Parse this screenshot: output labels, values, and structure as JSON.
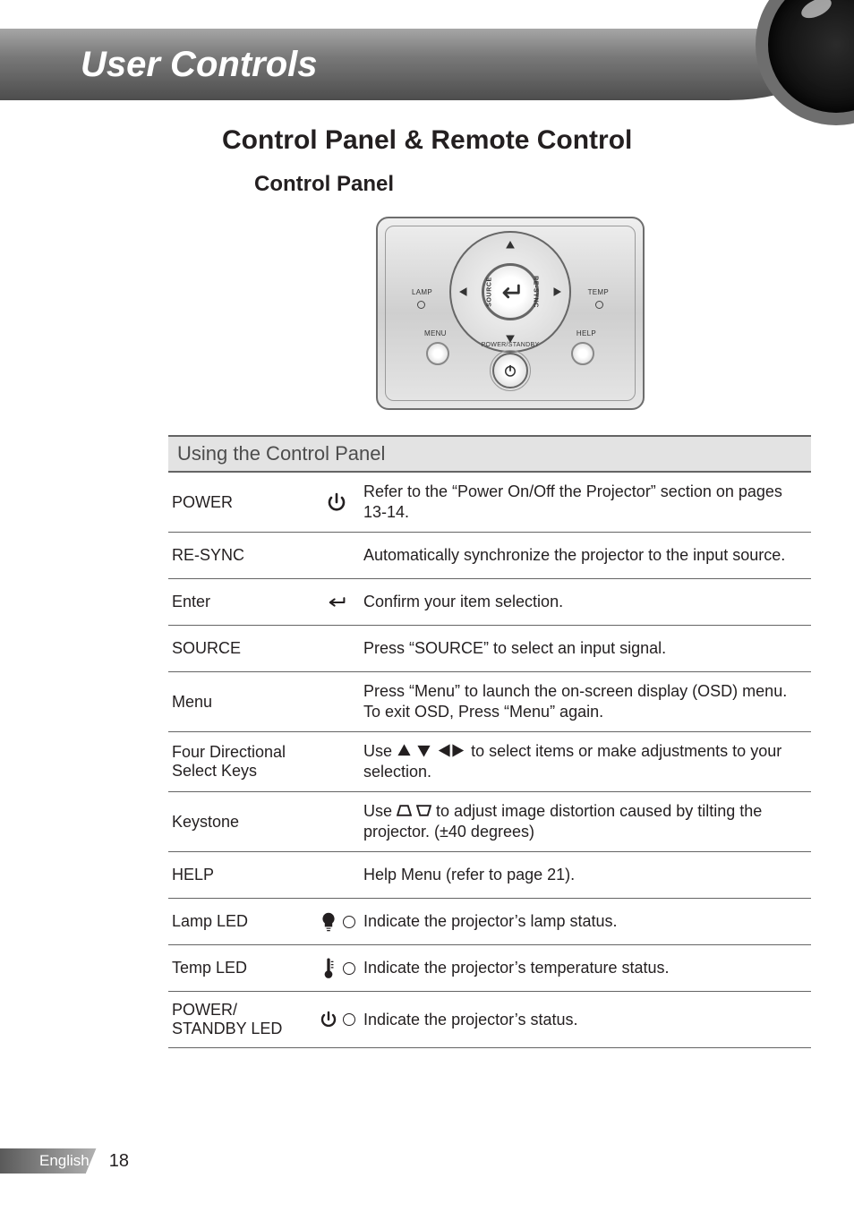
{
  "banner_title": "User Controls",
  "page_title": "Control Panel & Remote Control",
  "section_title": "Control Panel",
  "device": {
    "lamp_lbl": "LAMP",
    "temp_lbl": "TEMP",
    "menu_lbl": "MENU",
    "help_lbl": "HELP",
    "source_lbl": "SOURCE",
    "resync_lbl": "RE-SYNC",
    "power_lbl": "POWER/STANDBY"
  },
  "table": {
    "heading": "Using the Control Panel",
    "rows": {
      "power": {
        "label": "POWER",
        "desc": "Refer to the “Power On/Off the Projector” section on pages 13-14."
      },
      "resync": {
        "label": "RE-SYNC",
        "desc": "Automatically synchronize the projector to the input source."
      },
      "enter": {
        "label": "Enter",
        "desc": "Confirm your item selection."
      },
      "source": {
        "label": "SOURCE",
        "desc": "Press “SOURCE” to select an input signal."
      },
      "menu": {
        "label": "Menu",
        "desc": "Press “Menu” to launch the on-screen display (OSD) menu. To exit OSD, Press “Menu” again."
      },
      "fourkeys": {
        "label": "Four Directional Select Keys",
        "desc_pre": "Use ",
        "desc_post": " to select items or make adjustments to your selection."
      },
      "keystone": {
        "label": "Keystone",
        "desc_pre": "Use ",
        "desc_post": " to adjust image distortion caused by tilting the projector. (±40 degrees)"
      },
      "help": {
        "label": "HELP",
        "desc": "Help Menu (refer to page 21)."
      },
      "lampled": {
        "label": "Lamp LED",
        "desc": "Indicate the projector’s lamp status."
      },
      "templed": {
        "label": "Temp LED",
        "desc": "Indicate the projector’s temperature status."
      },
      "pwrled": {
        "label": "POWER/\nSTANDBY LED",
        "desc": "Indicate the projector’s status."
      }
    }
  },
  "footer": {
    "lang": "English",
    "page": "18"
  }
}
